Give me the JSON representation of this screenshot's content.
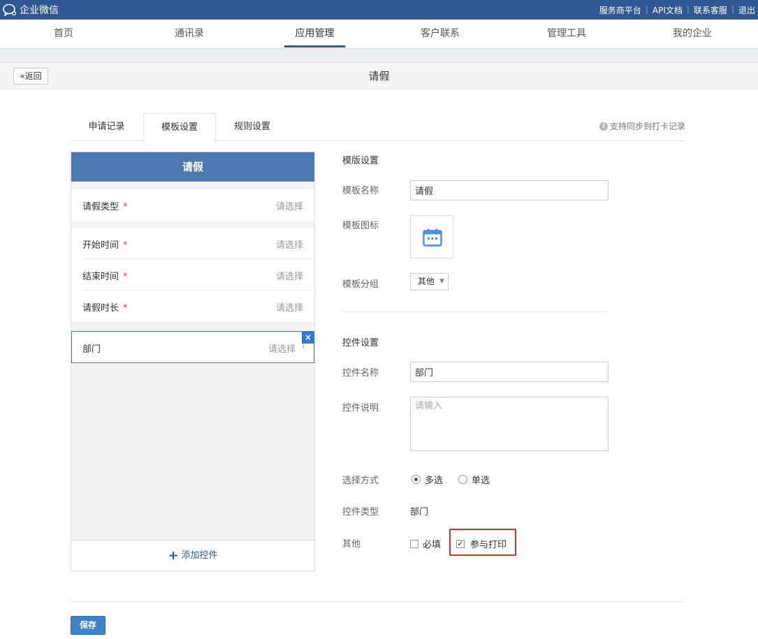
{
  "topbar": {
    "app_name": "企业微信",
    "links": [
      "服务商平台",
      "API文档",
      "联系客服",
      "退出"
    ]
  },
  "nav": {
    "items": [
      "首页",
      "通讯录",
      "应用管理",
      "客户联系",
      "管理工具",
      "我的企业"
    ],
    "active": "应用管理"
  },
  "page": {
    "back_label": "返回",
    "title": "请假"
  },
  "tabs": {
    "items": [
      "申请记录",
      "模板设置",
      "规则设置"
    ],
    "active": "模板设置",
    "sync_note": "支持同步到打卡记录"
  },
  "preview": {
    "header": "请假",
    "fields": [
      {
        "label": "请假类型",
        "required": "*",
        "value": "请选择"
      },
      {
        "label": "开始时间",
        "required": "*",
        "value": "请选择"
      },
      {
        "label": "结束时间",
        "required": "*",
        "value": "请选择"
      },
      {
        "label": "请假时长",
        "required": "*",
        "value": "请选择"
      }
    ],
    "selected_field": {
      "label": "部门",
      "value": "请选择"
    },
    "close_label": "×",
    "add_control": "添加控件"
  },
  "template_settings": {
    "section_title": "模版设置",
    "name_label": "模板名称",
    "name_value": "请假",
    "icon_label": "模板图标",
    "icon": "calendar-icon",
    "group_label": "模板分组",
    "group_value": "其他"
  },
  "control_settings": {
    "section_title": "控件设置",
    "name_label": "控件名称",
    "name_value": "部门",
    "desc_label": "控件说明",
    "desc_placeholder": "请输入",
    "select_mode_label": "选择方式",
    "select_modes": [
      "多选",
      "单选"
    ],
    "select_mode_active": "多选",
    "type_label": "控件类型",
    "type_value": "部门",
    "other_label": "其他",
    "required_option": "必填",
    "print_option": "参与打印",
    "print_checked": true,
    "required_checked": false
  },
  "save_label": "保存",
  "colors": {
    "topbar": "#2f5791",
    "preview_header": "#4e79b0",
    "highlight": "#e02b2b",
    "save_button": "#3f82c6"
  }
}
